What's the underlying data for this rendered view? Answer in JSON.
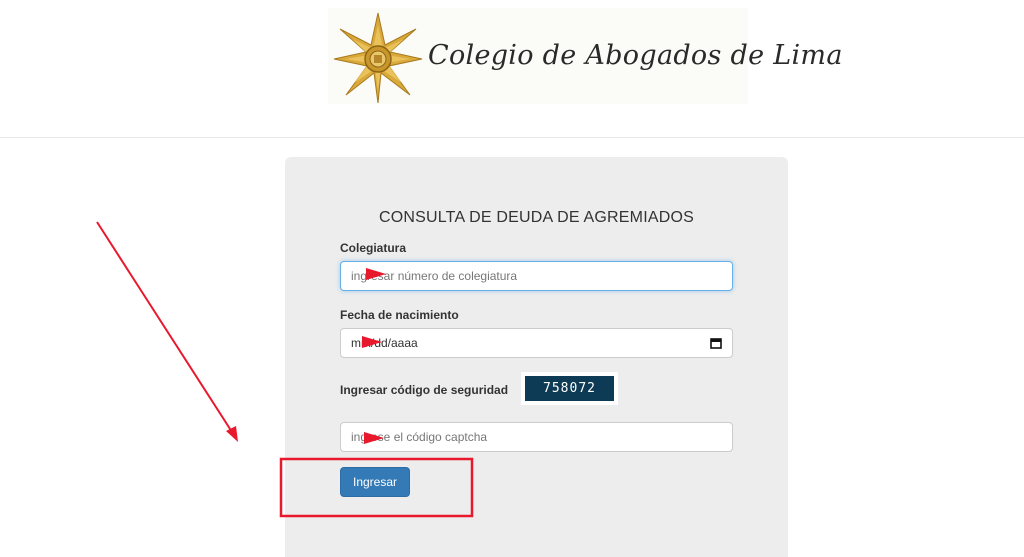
{
  "header": {
    "logo_text": "Colegio de Abogados de Lima"
  },
  "form": {
    "title": "CONSULTA DE DEUDA DE AGREMIADOS",
    "colegiatura": {
      "label": "Colegiatura",
      "placeholder": "ingresar número de colegiatura"
    },
    "birth_date": {
      "label": "Fecha de nacimiento",
      "value": "mm/dd/aaaa"
    },
    "security": {
      "label": "Ingresar código de seguridad",
      "code": "758072",
      "placeholder": "ingrese el código captcha"
    },
    "submit_label": "Ingresar"
  },
  "colors": {
    "accent": "#337ab7",
    "panel": "#ededed",
    "captcha": "#0d3a55",
    "annotation": "#e8192c"
  },
  "icons": [
    "star-emblem-icon",
    "calendar-icon"
  ]
}
